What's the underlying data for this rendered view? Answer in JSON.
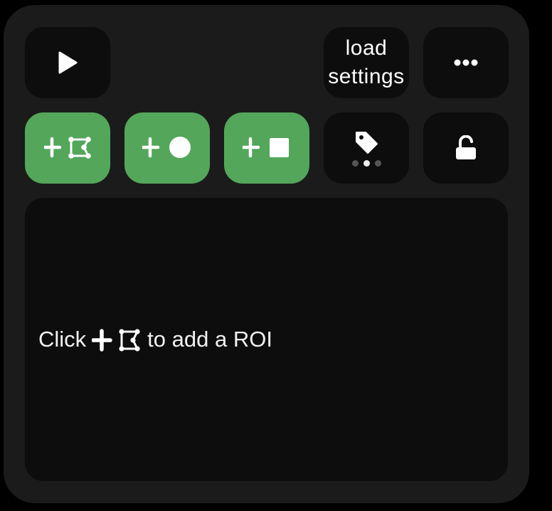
{
  "toolbar": {
    "play_icon": "play-icon",
    "load_settings_label": "load\nsettings",
    "more_icon": "more-horizontal-icon",
    "add_polygon_roi_icon": "add-polygon-roi-icon",
    "add_ellipse_roi_icon": "add-ellipse-roi-icon",
    "add_rectangle_roi_icon": "add-rectangle-roi-icon",
    "tag_icon": "tag-icon",
    "tag_page_dots": {
      "count": 3,
      "active_index": 1
    },
    "lock_icon": "unlocked-lock-icon"
  },
  "roi_panel": {
    "hint_prefix": "Click",
    "hint_icon": "add-polygon-roi-icon",
    "hint_suffix": "to add a ROI"
  },
  "colors": {
    "background": "#000000",
    "panel": "#1b1b1b",
    "button": "#0d0d0d",
    "accent_green": "#54a65a",
    "text": "#ffffff"
  }
}
